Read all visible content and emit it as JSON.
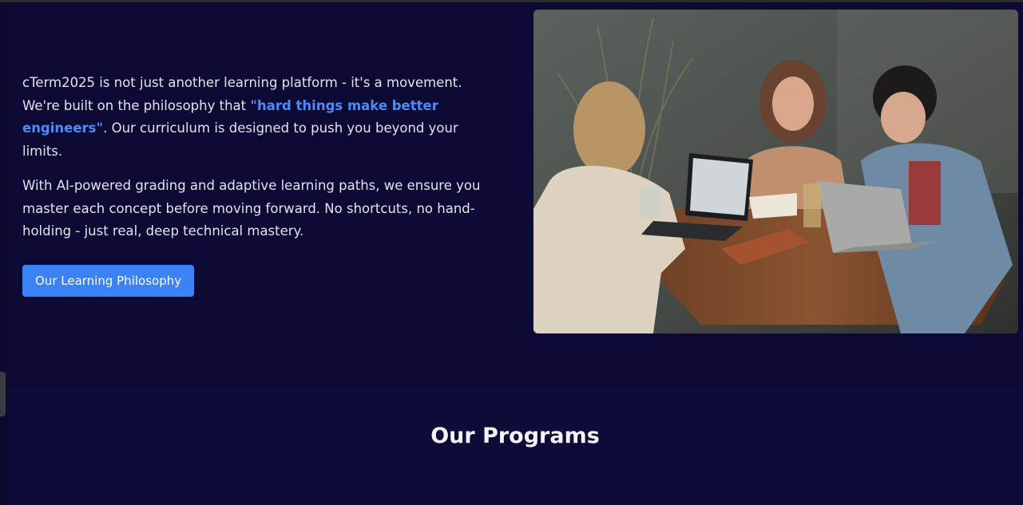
{
  "about": {
    "para1_pre": "cTerm2025 is not just another learning platform - it's a movement. We're built on the philosophy that ",
    "para1_highlight": "\"hard things make better engineers\"",
    "para1_post": ". Our curriculum is designed to push you beyond your limits.",
    "para2": "With AI-powered grading and adaptive learning paths, we ensure you master each concept before moving forward. No shortcuts, no hand-holding - just real, deep technical mastery.",
    "button_label": "Our Learning Philosophy"
  },
  "programs": {
    "title": "Our Programs"
  },
  "colors": {
    "background": "#0c0a35",
    "accent": "#3b82f6",
    "highlight": "#4a8cf7"
  }
}
